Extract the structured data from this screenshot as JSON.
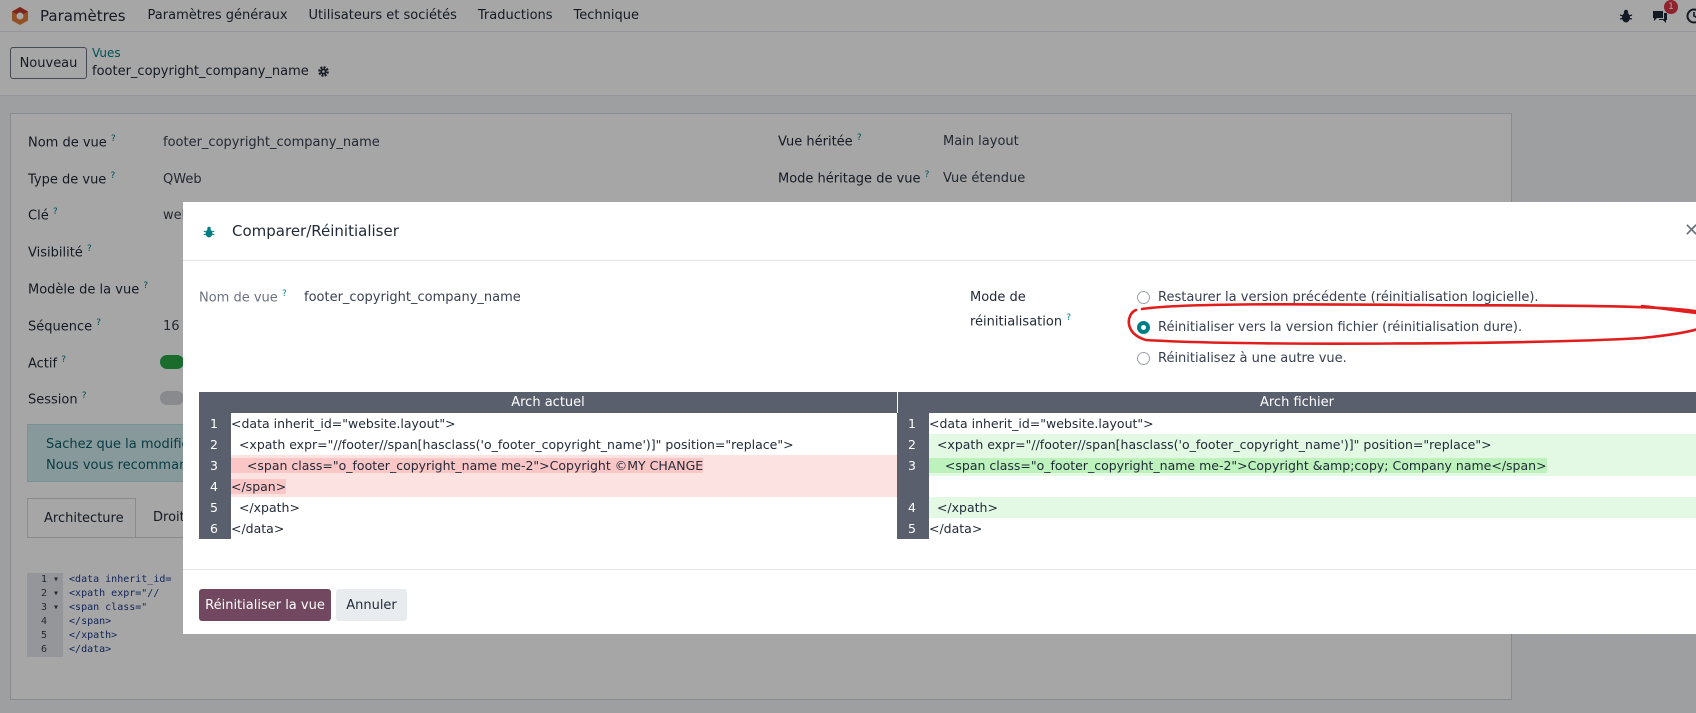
{
  "app": {
    "name": "Paramètres"
  },
  "menu": [
    "Paramètres généraux",
    "Utilisateurs et sociétés",
    "Traductions",
    "Technique"
  ],
  "navbar": {
    "messages_badge": "1"
  },
  "control": {
    "new_button": "Nouveau",
    "breadcrumb_parent": "Vues",
    "breadcrumb_current": "footer_copyright_company_name"
  },
  "form": {
    "name_label": "Nom de vue",
    "name_value": "footer_copyright_company_name",
    "type_label": "Type de vue",
    "type_value": "QWeb",
    "key_label": "Clé",
    "key_value": "web",
    "visibility_label": "Visibilité",
    "model_label": "Modèle de la vue",
    "sequence_label": "Séquence",
    "sequence_value": "16",
    "active_label": "Actif",
    "session_label": "Session",
    "inherit_label": "Vue héritée",
    "inherit_value": "Main layout",
    "inherit_mode_label": "Mode héritage de vue",
    "inherit_mode_value": "Vue étendue",
    "alert_line1": "Sachez que la modifica",
    "alert_line2": "Nous vous recomman",
    "tab_architecture": "Architecture",
    "tab_other": "Droit",
    "code_lines": [
      "<data inherit_id=",
      "  <xpath expr=\"//",
      "    <span class=\"",
      "</span>",
      "  </xpath>",
      "</data>"
    ]
  },
  "modal": {
    "title": "Comparer/Réinitialiser",
    "name_label": "Nom de vue",
    "name_value": "footer_copyright_company_name",
    "mode_label_line1": "Mode de",
    "mode_label_line2": "réinitialisation",
    "options": [
      "Restaurer la version précédente (réinitialisation logicielle).",
      "Réinitialiser vers la version fichier (réinitialisation dure).",
      "Réinitialisez à une autre vue."
    ],
    "selected_option": 1,
    "left_header": "Arch actuel",
    "right_header": "Arch fichier",
    "left_lines": [
      {
        "n": "1",
        "text": "<data inherit_id=\"website.layout\">"
      },
      {
        "n": "2",
        "text": "  <xpath expr=\"//footer//span[hasclass('o_footer_copyright_name')]\" position=\"replace\">"
      },
      {
        "n": "3",
        "text": "    <span class=\"o_footer_copyright_name me-2\">Copyright ©MY CHANGE"
      },
      {
        "n": "4",
        "text": "</span>"
      },
      {
        "n": "5",
        "text": "  </xpath>"
      },
      {
        "n": "6",
        "text": "</data>"
      }
    ],
    "right_lines": [
      {
        "n": "1",
        "text": "<data inherit_id=\"website.layout\">"
      },
      {
        "n": "2",
        "text": "  <xpath expr=\"//footer//span[hasclass('o_footer_copyright_name')]\" position=\"replace\">"
      },
      {
        "n": "3",
        "text": "    <span class=\"o_footer_copyright_name me-2\">Copyright &amp;copy; Company name</span>"
      },
      {
        "n": "",
        "text": ""
      },
      {
        "n": "4",
        "text": "  </xpath>"
      },
      {
        "n": "5",
        "text": "</data>"
      }
    ],
    "reset_button": "Réinitialiser la vue",
    "cancel_button": "Annuler"
  }
}
